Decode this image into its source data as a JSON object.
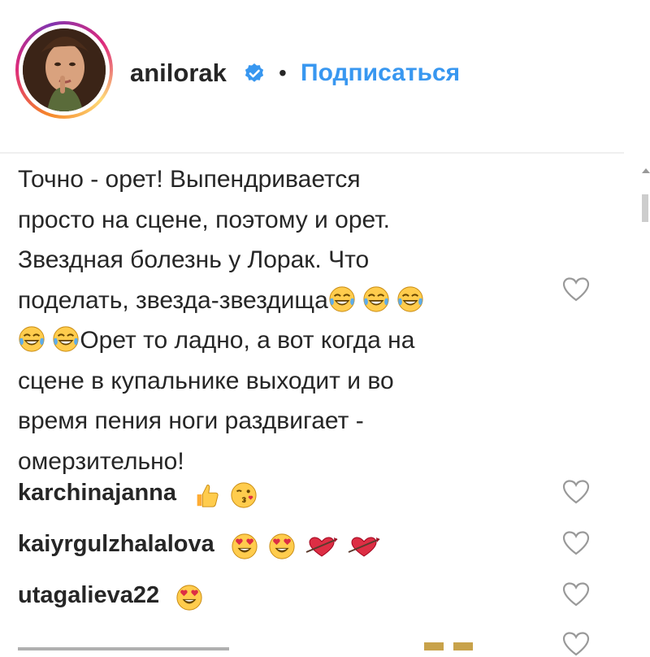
{
  "post_header": {
    "username": "anilorak",
    "separator": "•",
    "follow_label": "Подписаться"
  },
  "caption": {
    "line_1": "Точно - орет! Выпендривается",
    "line_2": "просто на сцене, поэтому и орет.",
    "line_3": "Звездная болезнь у Лорак. Что",
    "line_4_text": "поделать, звезда-звездища",
    "line_5_text": "Орет то ладно, а вот когда на",
    "line_6": "сцене в купальнике выходит и во",
    "line_7": "время пения ноги раздвигает -",
    "line_8": "омерзительно!"
  },
  "comments": [
    {
      "username": "karchinajanna",
      "emojis": [
        "thumbs-up",
        "face-blowing-kiss"
      ]
    },
    {
      "username": "kaiyrgulzhalalova",
      "emojis": [
        "heart-eyes",
        "heart-eyes",
        "red-heart-arrow",
        "red-heart-arrow"
      ]
    },
    {
      "username": "utagalieva22",
      "emojis": [
        "heart-eyes"
      ]
    }
  ],
  "colors": {
    "text": "#262626",
    "link": "#3897f0",
    "verified": "#3897f0",
    "divider": "#efefef",
    "heart_outline": "#999999"
  },
  "icons": {
    "verified": "verified-badge-icon",
    "like": "heart-outline-icon",
    "laugh": "tears-of-joy-emoji"
  }
}
